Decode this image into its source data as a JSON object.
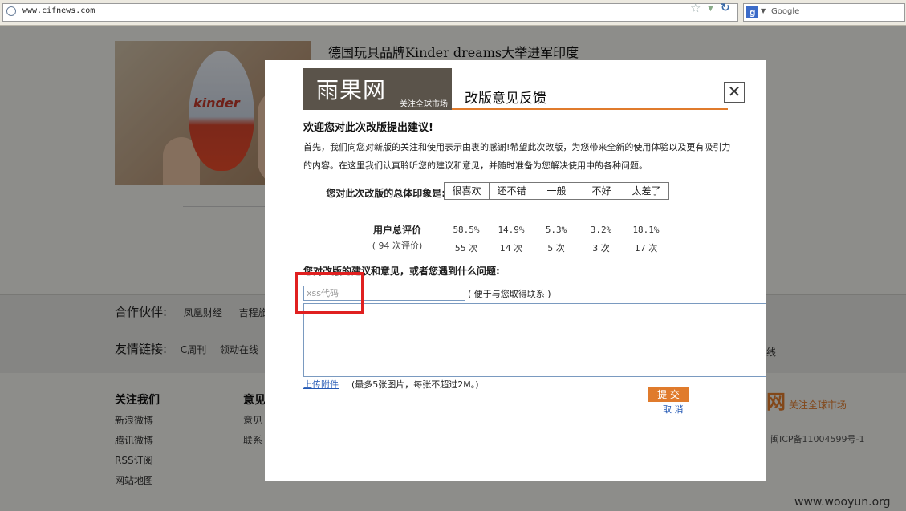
{
  "browser": {
    "url": "www.cifnews.com",
    "search_engine_label": "g",
    "search_placeholder": "Google"
  },
  "article": {
    "title": "德国玩具品牌Kinder dreams大举进军印度",
    "image_text": "kinder"
  },
  "footer": {
    "partners_label": "合作伙伴:",
    "partners": [
      "凤凰财经",
      "吉程旅"
    ],
    "links_label": "友情链接:",
    "links": [
      "C周刊",
      "领动在线"
    ],
    "links_extra": "线",
    "follow": {
      "heading": "关注我们",
      "items": [
        "新浪微博",
        "腾讯微博",
        "RSS订阅",
        "网站地图"
      ]
    },
    "feedback": {
      "heading": "意见",
      "items": [
        "意见",
        "联系"
      ]
    },
    "logo_tagline": "关注全球市场",
    "icp": "闽ICP备11004599号-1"
  },
  "modal": {
    "logo_text": "雨果网",
    "logo_tagline": "关注全球市场",
    "title": "改版意见反馈",
    "close_glyph": "✕",
    "welcome": "欢迎您对此次改版提出建议!",
    "intro": "首先，我们向您对新版的关注和使用表示由衷的感谢!希望此次改版，为您带来全新的使用体验以及更有吸引力的内容。在这里我们认真聆听您的建议和意见，并随时准备为您解决使用中的各种问题。",
    "rating_question": "您对此次改版的总体印象是:",
    "rating_options": [
      "很喜欢",
      "还不错",
      "一般",
      "不好",
      "太差了"
    ],
    "eval_label": "用户总评价",
    "eval_count": "( 94 次评价)",
    "percentages": [
      "58.5%",
      "14.9%",
      "5.3%",
      "3.2%",
      "18.1%"
    ],
    "counts": [
      "55 次",
      "14 次",
      "5 次",
      "3 次",
      "17 次"
    ],
    "suggest_question": "您对改版的建议和意见，或者您遇到什么问题:",
    "contact_value": "xss代码",
    "contact_note": "( 便于与您取得联系 )",
    "upload_label": "上传附件",
    "upload_note": "(最多5张图片，每张不超过2M。)",
    "submit_label": "提 交",
    "cancel_label": "取 消"
  },
  "watermark": "www.wooyun.org",
  "colors": {
    "accent_orange": "#e07b2c",
    "highlight_red": "#e02020",
    "link_blue": "#2358b4"
  }
}
